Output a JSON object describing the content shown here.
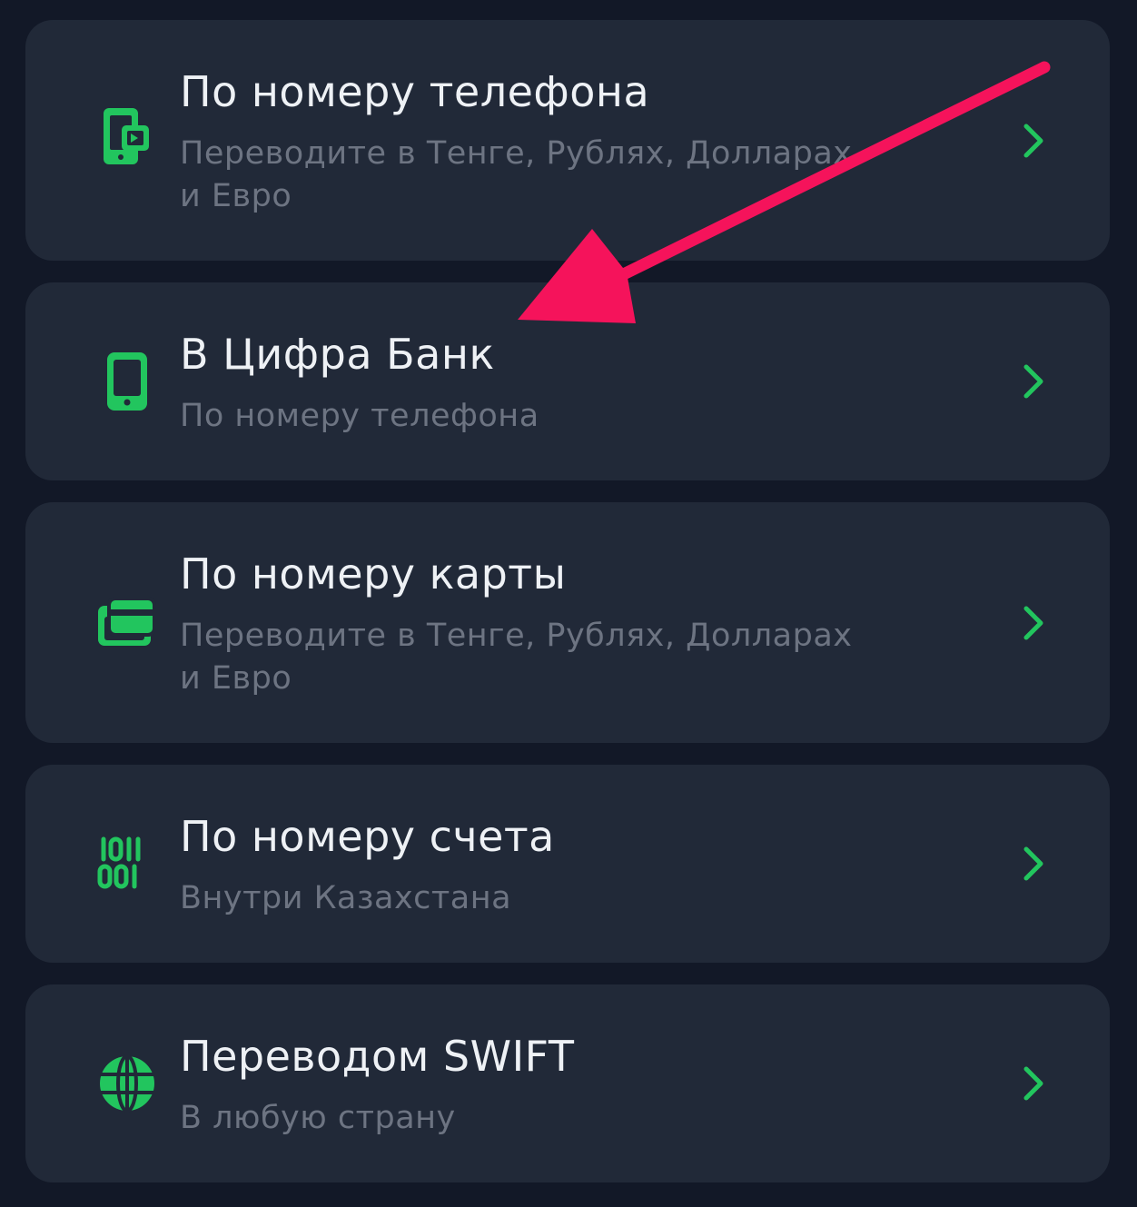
{
  "colors": {
    "background": "#121827",
    "card": "#212938",
    "accent": "#22C55E",
    "title": "#EEF1F5",
    "subtitle": "#6D7482",
    "annotation_arrow": "#F5135B"
  },
  "transfer_options": [
    {
      "icon": "phone-transfer-icon",
      "title": "По номеру телефона",
      "subtitle": "Переводите в Тенге, Рублях, Долларах и Евро"
    },
    {
      "icon": "smartphone-icon",
      "title": "В Цифра Банк",
      "subtitle": "По номеру телефона"
    },
    {
      "icon": "card-icon",
      "title": "По номеру карты",
      "subtitle": "Переводите в Тенге, Рублях, Долларах и Евро"
    },
    {
      "icon": "binary-icon",
      "title": "По номеру счета",
      "subtitle": "Внутри Казахстана"
    },
    {
      "icon": "globe-icon",
      "title": "Переводом SWIFT",
      "subtitle": "В любую страну"
    }
  ]
}
